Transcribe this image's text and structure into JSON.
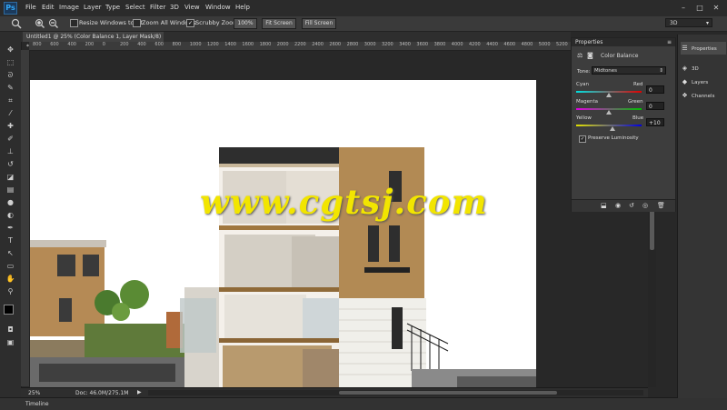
{
  "app": {
    "logo": "Ps"
  },
  "menus": [
    "File",
    "Edit",
    "Image",
    "Layer",
    "Type",
    "Select",
    "Filter",
    "3D",
    "View",
    "Window",
    "Help"
  ],
  "window_controls": {
    "minimize": "–",
    "maximize": "□",
    "close": "✕"
  },
  "options_bar": {
    "tool_icon": "zoom-tool-icon",
    "resize_label": "Resize Windows to Fit",
    "zoom_all_label": "Zoom All Windows",
    "scrubby_label": "Scrubby Zoom",
    "btn_100": "100%",
    "btn_fit": "Fit Screen",
    "btn_fill": "Fill Screen",
    "workspace": "3D"
  },
  "document": {
    "tab_title": "Untitled1 @ 25% (Color Balance 1, Layer Mask/8) *"
  },
  "ruler": {
    "ticks": [
      "800",
      "600",
      "400",
      "200",
      "0",
      "200",
      "400",
      "600",
      "800",
      "1000",
      "1200",
      "1400",
      "1600",
      "1800",
      "2000",
      "2200",
      "2400",
      "2600",
      "2800",
      "3000",
      "3200",
      "3400",
      "3600",
      "3800",
      "4000",
      "4200",
      "4400",
      "4600",
      "4800",
      "5000",
      "5200"
    ]
  },
  "watermark": "www.cgtsj.com",
  "status": {
    "zoom": "25%",
    "doc": "Doc: 46.0M/275.1M"
  },
  "timeline": {
    "label": "Timeline"
  },
  "properties": {
    "panel_title": "Properties",
    "adjustment_name": "Color Balance",
    "tone_label": "Tone:",
    "tone_value": "Midtones",
    "sliders": [
      {
        "left": "Cyan",
        "right": "Red",
        "value": "0",
        "position": 0.5
      },
      {
        "left": "Magenta",
        "right": "Green",
        "value": "0",
        "position": 0.5
      },
      {
        "left": "Yellow",
        "right": "Blue",
        "value": "+10",
        "position": 0.55
      }
    ],
    "preserve_label": "Preserve Luminosity",
    "preserve_checked": true
  },
  "dock": {
    "items": [
      {
        "label": "Properties",
        "icon": "properties-icon"
      },
      {
        "label": "3D",
        "icon": "3d-icon"
      },
      {
        "label": "Layers",
        "icon": "layers-icon"
      },
      {
        "label": "Channels",
        "icon": "channels-icon"
      }
    ]
  },
  "colors": {
    "accent": "#32a7f6",
    "watermark": "#f2e500",
    "canvas": "#ffffff"
  }
}
